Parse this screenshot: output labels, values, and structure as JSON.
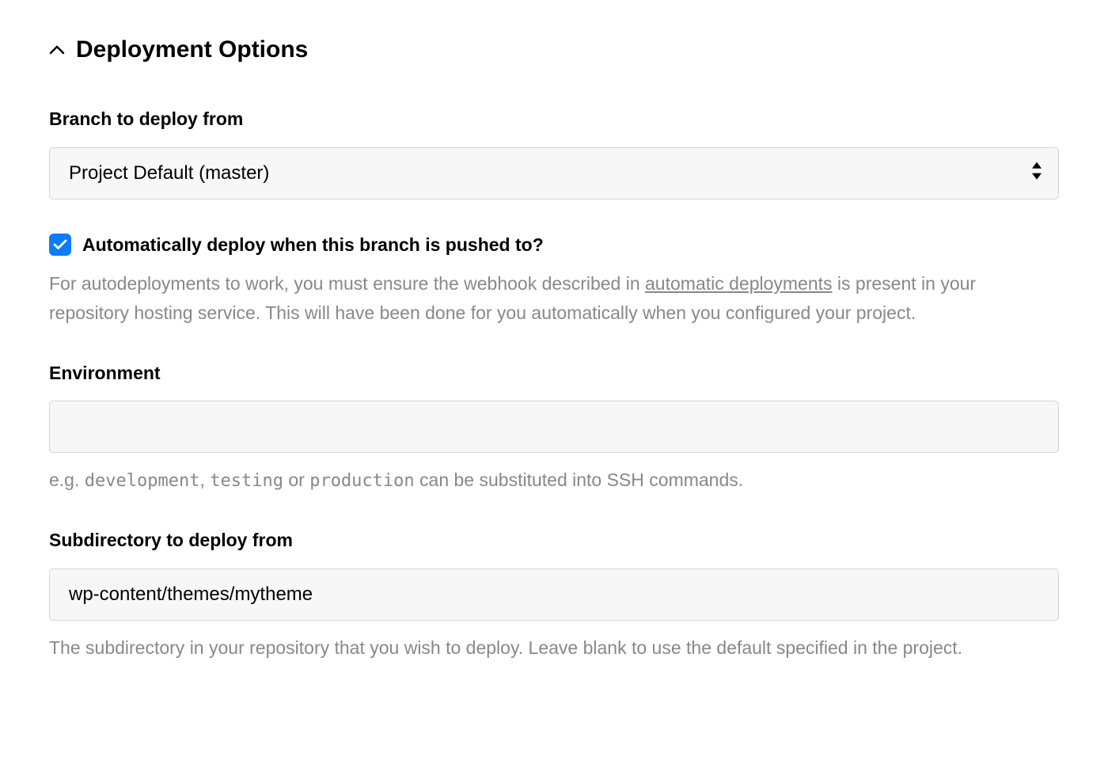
{
  "section": {
    "title": "Deployment Options"
  },
  "branch": {
    "label": "Branch to deploy from",
    "selected": "Project Default (master)"
  },
  "autodeploy": {
    "checked": true,
    "label": "Automatically deploy when this branch is pushed to?",
    "help_before_link": "For autodeployments to work, you must ensure the webhook described in ",
    "help_link_text": "automatic deployments",
    "help_after_link": " is present in your repository hosting service. This will have been done for you automatically when you configured your project."
  },
  "environment": {
    "label": "Environment",
    "value": "",
    "help_prefix": "e.g. ",
    "help_code1": "development",
    "help_sep1": ", ",
    "help_code2": "testing",
    "help_sep2": " or ",
    "help_code3": "production",
    "help_suffix": " can be substituted into SSH commands."
  },
  "subdirectory": {
    "label": "Subdirectory to deploy from",
    "value": "wp-content/themes/mytheme",
    "help": "The subdirectory in your repository that you wish to deploy. Leave blank to use the default specified in the project."
  }
}
